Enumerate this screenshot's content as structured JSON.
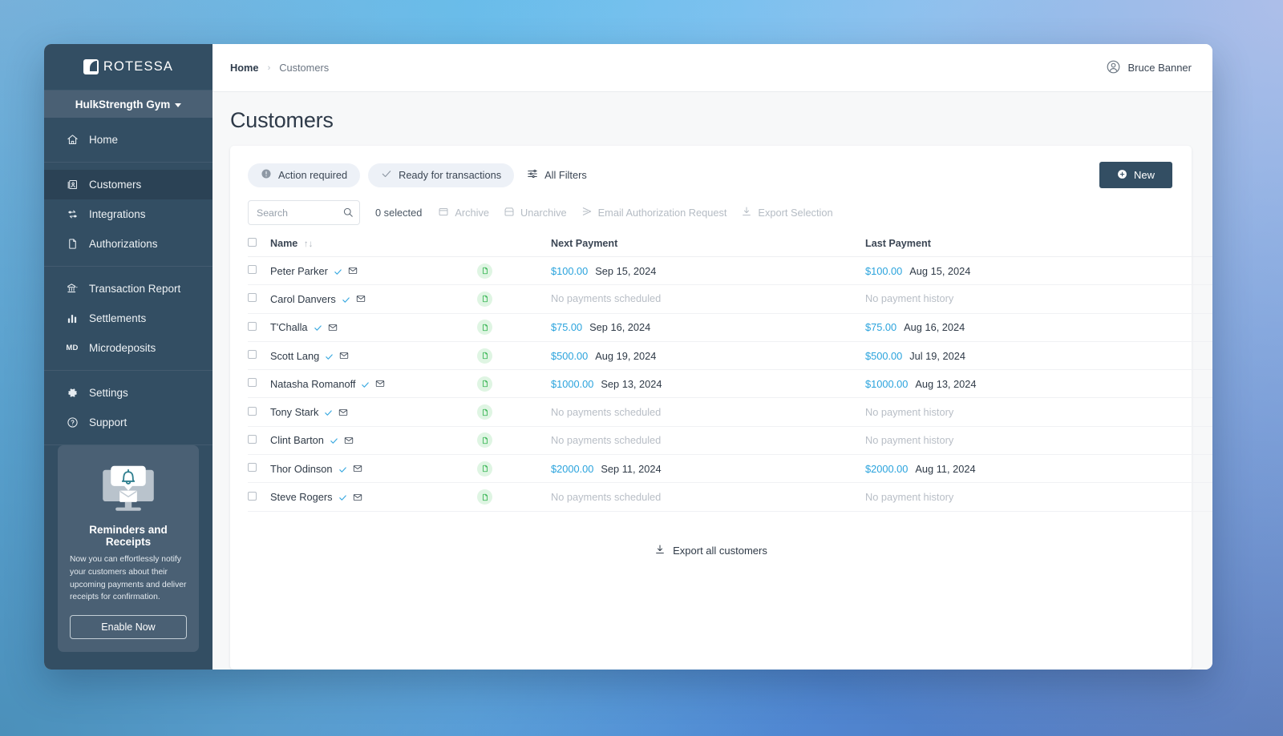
{
  "app": {
    "logo_text": "ROTESSA",
    "org_name": "HulkStrength Gym"
  },
  "sidebar": {
    "groups": [
      {
        "items": [
          {
            "icon": "home-icon",
            "label": "Home",
            "active": false
          }
        ]
      },
      {
        "items": [
          {
            "icon": "customers-icon",
            "label": "Customers",
            "active": true
          },
          {
            "icon": "integrations-icon",
            "label": "Integrations",
            "active": false
          },
          {
            "icon": "authorizations-icon",
            "label": "Authorizations",
            "active": false
          }
        ]
      },
      {
        "items": [
          {
            "icon": "transaction-report-icon",
            "label": "Transaction Report",
            "active": false
          },
          {
            "icon": "settlements-icon",
            "label": "Settlements",
            "active": false
          },
          {
            "icon": "microdeposits-icon",
            "label": "Microdeposits",
            "active": false
          }
        ]
      },
      {
        "items": [
          {
            "icon": "settings-icon",
            "label": "Settings",
            "active": false
          },
          {
            "icon": "support-icon",
            "label": "Support",
            "active": false
          }
        ]
      }
    ],
    "promo": {
      "title": "Reminders and Receipts",
      "body": "Now you can effortlessly notify your customers about their upcoming payments and deliver receipts for confirmation.",
      "button_label": "Enable Now"
    }
  },
  "topbar": {
    "breadcrumb_home": "Home",
    "breadcrumb_separator": "›",
    "breadcrumb_current": "Customers",
    "user_name": "Bruce Banner"
  },
  "page": {
    "title": "Customers"
  },
  "filters": {
    "chips": [
      {
        "label": "Action required",
        "icon": "alert-circle-icon"
      },
      {
        "label": "Ready for transactions",
        "icon": "check-icon"
      }
    ],
    "all_filters_label": "All Filters"
  },
  "actions": {
    "new_label": "New"
  },
  "toolbar": {
    "search_placeholder": "Search",
    "search_value": "",
    "selected_label": "0 selected",
    "buttons": [
      {
        "label": "Archive",
        "icon": "archive-icon"
      },
      {
        "label": "Unarchive",
        "icon": "unarchive-icon"
      },
      {
        "label": "Email Authorization Request",
        "icon": "send-icon"
      },
      {
        "label": "Export Selection",
        "icon": "download-icon"
      }
    ]
  },
  "table": {
    "headers": {
      "name": "Name",
      "next_payment": "Next Payment",
      "last_payment": "Last Payment"
    },
    "sort_icons": "↑↓",
    "rows": [
      {
        "name": "Peter Parker",
        "verified": true,
        "email": true,
        "doc": true,
        "next_amount": "$100.00",
        "next_date": "Sep 15, 2024",
        "next_empty": "",
        "last_amount": "$100.00",
        "last_date": "Aug 15, 2024",
        "last_empty": ""
      },
      {
        "name": "Carol Danvers",
        "verified": true,
        "email": true,
        "doc": true,
        "next_amount": "",
        "next_date": "",
        "next_empty": "No payments scheduled",
        "last_amount": "",
        "last_date": "",
        "last_empty": "No payment history"
      },
      {
        "name": "T'Challa",
        "verified": true,
        "email": true,
        "doc": true,
        "next_amount": "$75.00",
        "next_date": "Sep 16, 2024",
        "next_empty": "",
        "last_amount": "$75.00",
        "last_date": "Aug 16, 2024",
        "last_empty": ""
      },
      {
        "name": "Scott Lang",
        "verified": true,
        "email": true,
        "doc": true,
        "next_amount": "$500.00",
        "next_date": "Aug 19, 2024",
        "next_empty": "",
        "last_amount": "$500.00",
        "last_date": "Jul 19, 2024",
        "last_empty": ""
      },
      {
        "name": "Natasha Romanoff",
        "verified": true,
        "email": true,
        "doc": true,
        "next_amount": "$1000.00",
        "next_date": "Sep 13, 2024",
        "next_empty": "",
        "last_amount": "$1000.00",
        "last_date": "Aug 13, 2024",
        "last_empty": ""
      },
      {
        "name": "Tony Stark",
        "verified": true,
        "email": true,
        "doc": true,
        "next_amount": "",
        "next_date": "",
        "next_empty": "No payments scheduled",
        "last_amount": "",
        "last_date": "",
        "last_empty": "No payment history"
      },
      {
        "name": "Clint Barton",
        "verified": true,
        "email": true,
        "doc": true,
        "next_amount": "",
        "next_date": "",
        "next_empty": "No payments scheduled",
        "last_amount": "",
        "last_date": "",
        "last_empty": "No payment history"
      },
      {
        "name": "Thor Odinson",
        "verified": true,
        "email": true,
        "doc": true,
        "next_amount": "$2000.00",
        "next_date": "Sep 11, 2024",
        "next_empty": "",
        "last_amount": "$2000.00",
        "last_date": "Aug 11, 2024",
        "last_empty": ""
      },
      {
        "name": "Steve Rogers",
        "verified": true,
        "email": true,
        "doc": true,
        "next_amount": "",
        "next_date": "",
        "next_empty": "No payments scheduled",
        "last_amount": "",
        "last_date": "",
        "last_empty": "No payment history"
      }
    ],
    "export_all_label": "Export all customers"
  },
  "colors": {
    "sidebar_bg": "#334e63",
    "sidebar_active": "#2b4255",
    "org_bar": "#4a6074",
    "accent_blue": "#2aa3dd",
    "badge_green": "#2fb24c",
    "badge_green_bg": "#dff5e3",
    "chip_bg": "#edf1f7",
    "muted_text": "#b8bec6"
  }
}
